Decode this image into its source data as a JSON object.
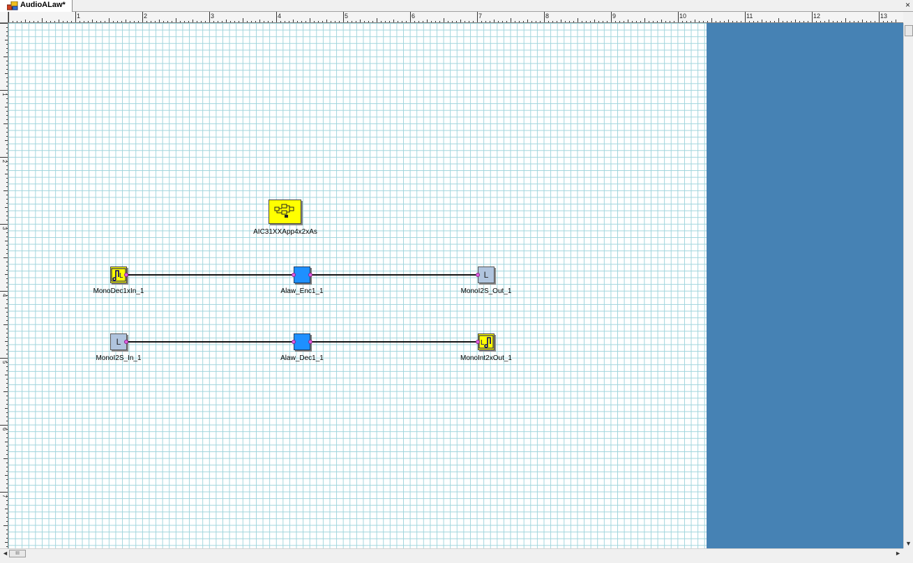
{
  "tab": {
    "title": "AudioALaw*",
    "icon": "diagram-app-icon",
    "close_glyph": "×"
  },
  "ruler": {
    "horizontal_labels": [
      "1",
      "2",
      "3",
      "4",
      "5",
      "6",
      "7",
      "8",
      "9",
      "10",
      "11",
      "12",
      "13"
    ],
    "vertical_labels": [
      "1",
      "2",
      "3",
      "4",
      "5",
      "6",
      "7"
    ]
  },
  "diagram": {
    "components": [
      {
        "id": "aic",
        "label": "AIC31XXApp4x2xAs",
        "kind": "system-block"
      },
      {
        "id": "monodec",
        "label": "MonoDec1xIn_1",
        "kind": "audio-in"
      },
      {
        "id": "enc",
        "label": "Alaw_Enc1_1",
        "kind": "encoder"
      },
      {
        "id": "i2sout",
        "label": "MonoI2S_Out_1",
        "kind": "i2s-out",
        "glyph": "L"
      },
      {
        "id": "i2sin",
        "label": "MonoI2S_In_1",
        "kind": "i2s-in",
        "glyph": "L"
      },
      {
        "id": "dec",
        "label": "Alaw_Dec1_1",
        "kind": "decoder"
      },
      {
        "id": "monoint",
        "label": "MonoInt2xOut_1",
        "kind": "audio-out"
      }
    ],
    "connections": [
      [
        "MonoDec1xIn_1",
        "Alaw_Enc1_1"
      ],
      [
        "Alaw_Enc1_1",
        "MonoI2S_Out_1"
      ],
      [
        "MonoI2S_In_1",
        "Alaw_Dec1_1"
      ],
      [
        "Alaw_Dec1_1",
        "MonoInt2xOut_1"
      ]
    ]
  },
  "colors": {
    "grid_line": "#9fd4dc",
    "outside_area": "#4682b4",
    "yellow_block": "#ffff00",
    "blue_block": "#1e90ff",
    "i2s_block": "#b0c4de",
    "port": "#e060e0"
  },
  "scrollbars": {
    "h_thumb_glyph": "III",
    "left_arrow": "◄",
    "right_arrow": "►",
    "down_arrow": "▼"
  }
}
